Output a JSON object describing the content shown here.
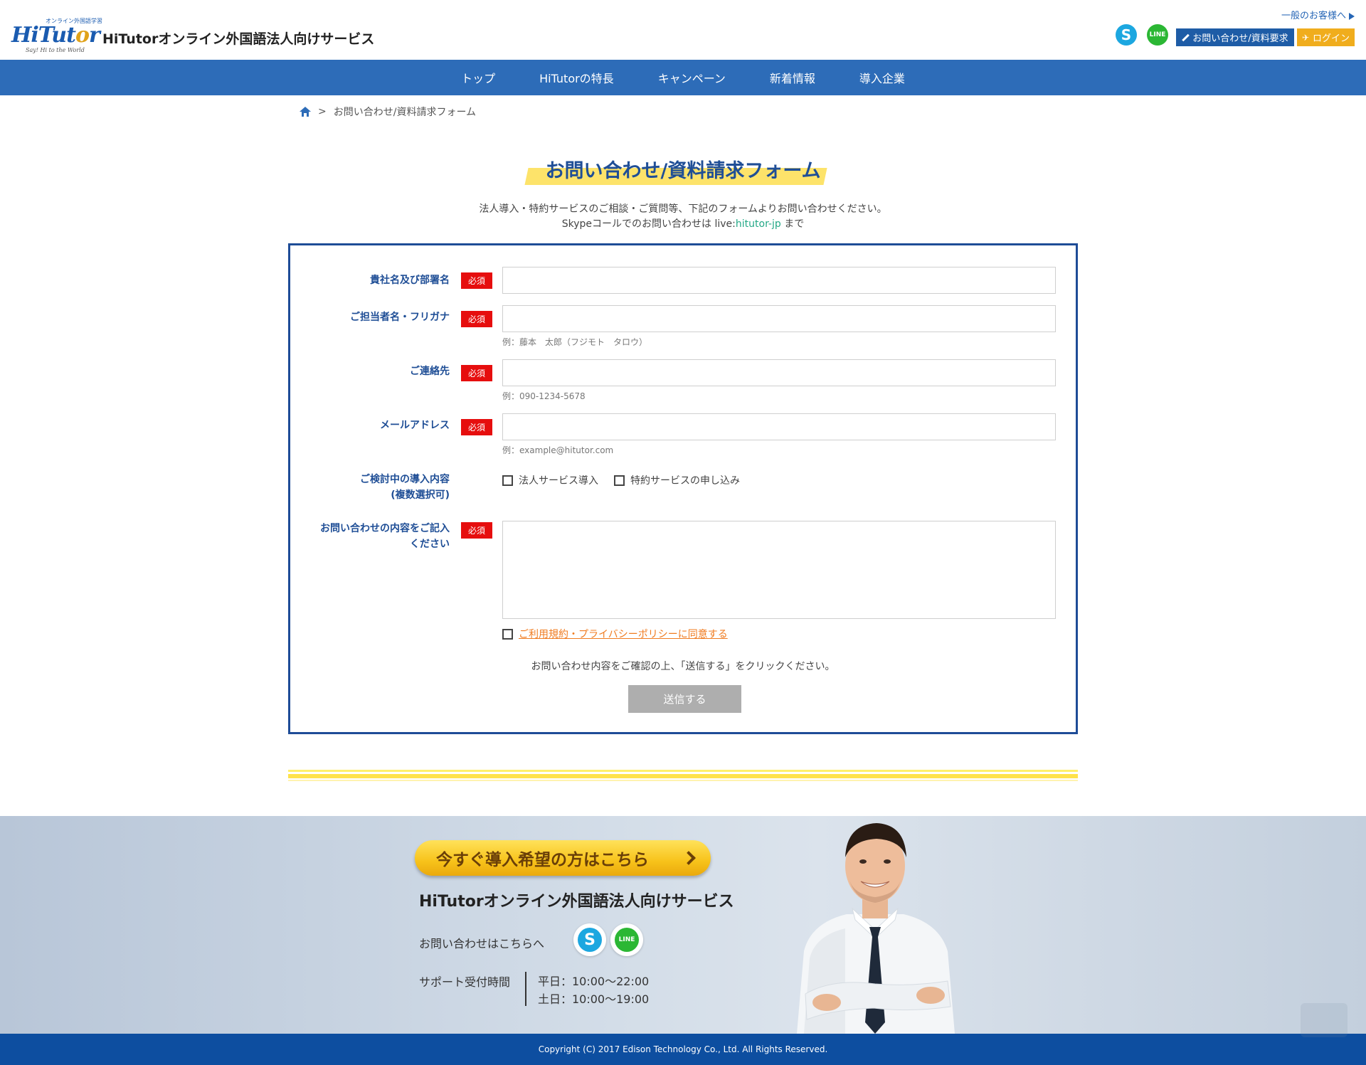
{
  "header": {
    "logo_top_text": "オンライン外国語学習",
    "logo_main": "HiTutor",
    "logo_sub": "Say! Hi to the World",
    "site_title": "HiTutorオンライン外国語法人向けサービス",
    "general_link": "一般のお客様へ",
    "contact_button": "お問い合わせ/資料要求",
    "login_button": "ログイン",
    "skype_icon_letter": "S",
    "line_icon_letter": "LINE"
  },
  "nav": {
    "items": [
      {
        "label": "トップ"
      },
      {
        "label": "HiTutorの特長"
      },
      {
        "label": "キャンペーン"
      },
      {
        "label": "新着情報"
      },
      {
        "label": "導入企業"
      }
    ]
  },
  "breadcrumb": {
    "separator": ">",
    "current": "お問い合わせ/資料請求フォーム"
  },
  "page": {
    "title": "お問い合わせ/資料請求フォーム",
    "lead_line1": "法人導入・特約サービスのご相談・ご質問等、下記のフォームよりお問い合わせください。",
    "lead_line2_prefix": "Skypeコールでのお問い合わせは live:",
    "lead_skype_id": "hitutor-jp",
    "lead_line2_suffix": " まで"
  },
  "form": {
    "required_badge": "必須",
    "company": {
      "label": "貴社名及び部署名",
      "value": ""
    },
    "name": {
      "label": "ご担当者名・フリガナ",
      "value": "",
      "hint": "例：藤本　太郎（フジモト　タロウ）"
    },
    "phone": {
      "label": "ご連絡先",
      "value": "",
      "hint": "例：090-1234-5678"
    },
    "email": {
      "label": "メールアドレス",
      "value": "",
      "hint": "例：example@hitutor.com"
    },
    "interest": {
      "label_line1": "ご検討中の導入内容",
      "label_line2": "(複数選択可)",
      "options": [
        {
          "label": "法人サービス導入",
          "checked": false
        },
        {
          "label": "特約サービスの申し込み",
          "checked": false
        }
      ]
    },
    "message": {
      "label_line1": "お問い合わせの内容をご記入",
      "label_line2": "ください",
      "value": ""
    },
    "agree_label": "ご利用規約・プライバシーポリシーに同意する",
    "confirm_text": "お問い合わせ内容をご確認の上、「送信する」をクリックください。",
    "submit_label": "送信する"
  },
  "banner": {
    "cta_label": "今すぐ導入希望の方はこちら",
    "title": "HiTutorオンライン外国語法人向けサービス",
    "contact_text": "お問い合わせはこちらへ",
    "support_label": "サポート受付時間",
    "hours_weekday": "平日：10:00～22:00",
    "hours_weekend": "土日：10:00～19:00"
  },
  "footer": {
    "copyright": "Copyright (C) 2017 Edison Technology Co., Ltd. All Rights Reserved."
  },
  "colors": {
    "brand_blue": "#2d6cb8",
    "title_blue": "#1f4e96",
    "required_red": "#e60e0e",
    "accent_yellow": "#f0ad1d",
    "link_orange": "#f07c21"
  }
}
